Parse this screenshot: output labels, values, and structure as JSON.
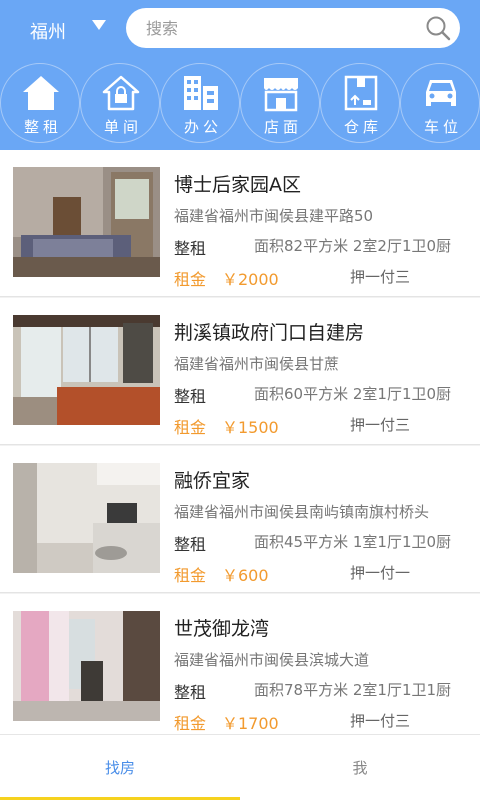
{
  "header": {
    "city": "福州",
    "search_placeholder": "搜索"
  },
  "categories": [
    {
      "label": "整租",
      "icon": "house-icon"
    },
    {
      "label": "单间",
      "icon": "room-lock-icon"
    },
    {
      "label": "办公",
      "icon": "office-building-icon"
    },
    {
      "label": "店面",
      "icon": "storefront-icon"
    },
    {
      "label": "仓库",
      "icon": "warehouse-box-icon"
    },
    {
      "label": "车位",
      "icon": "car-icon"
    }
  ],
  "listings": [
    {
      "title": "博士后家园A区",
      "address": "福建省福州市闽侯县建平路50",
      "type": "整租",
      "details": "面积82平方米  2室2厅1卫0厨",
      "rent_label": "租金",
      "rent": "￥2000",
      "deposit": "押一付三"
    },
    {
      "title": "荆溪镇政府门口自建房",
      "address": "福建省福州市闽侯县甘蔗",
      "type": "整租",
      "details": "面积60平方米  2室1厅1卫0厨",
      "rent_label": "租金",
      "rent": "￥1500",
      "deposit": "押一付三"
    },
    {
      "title": "融侨宜家",
      "address": "福建省福州市闽侯县南屿镇南旗村桥头",
      "type": "整租",
      "details": "面积45平方米  1室1厅1卫0厨",
      "rent_label": "租金",
      "rent": "￥600",
      "deposit": "押一付一"
    },
    {
      "title": "世茂御龙湾",
      "address": "福建省福州市闽侯县滨城大道",
      "type": "整租",
      "details": "面积78平方米  2室1厅1卫1厨",
      "rent_label": "租金",
      "rent": "￥1700",
      "deposit": "押一付三"
    }
  ],
  "tabs": {
    "find": "找房",
    "me": "我"
  },
  "colors": {
    "header_blue": "#6aa7f5",
    "price_orange": "#f29a2e",
    "active_tab": "#4a8ee8",
    "indicator_yellow": "#f6d21e"
  }
}
